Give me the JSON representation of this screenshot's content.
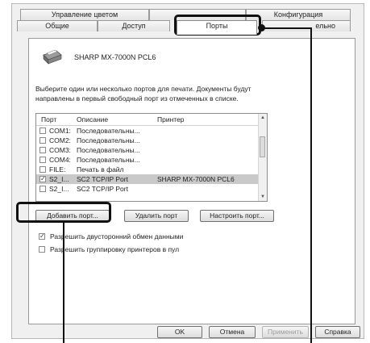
{
  "tabs": {
    "color_management": "Управление цветом",
    "config": "Конфигурация",
    "general": "Общие",
    "access": "Доступ",
    "ports": "Порты",
    "advanced_partial": "ельно"
  },
  "printer": {
    "name": "SHARP MX-7000N PCL6",
    "icon": "printer-icon"
  },
  "instructions": "Выберите один или несколько портов для печати. Документы будут направлены в первый свободный порт из отмеченных в списке.",
  "port_list": {
    "columns": [
      "Порт",
      "Описание",
      "Принтер"
    ],
    "rows": [
      {
        "port": "COM1:",
        "description": "Последовательны...",
        "printer": "",
        "checked": false,
        "selected": false
      },
      {
        "port": "COM2:",
        "description": "Последовательны...",
        "printer": "",
        "checked": false,
        "selected": false
      },
      {
        "port": "COM3:",
        "description": "Последовательны...",
        "printer": "",
        "checked": false,
        "selected": false
      },
      {
        "port": "COM4:",
        "description": "Последовательны...",
        "printer": "",
        "checked": false,
        "selected": false
      },
      {
        "port": "FILE:",
        "description": "Печать в файл",
        "printer": "",
        "checked": false,
        "selected": false
      },
      {
        "port": "S2_I...",
        "description": "SC2 TCP/IP Port",
        "printer": "SHARP MX-7000N PCL6",
        "checked": true,
        "selected": true
      },
      {
        "port": "S2_I...",
        "description": "SC2 TCP/IP Port",
        "printer": "",
        "checked": false,
        "selected": false
      }
    ]
  },
  "buttons": {
    "add_port": "Добавить порт...",
    "delete_port": "Удалить порт",
    "configure_port": "Настроить порт...",
    "ok": "OK",
    "cancel": "Отмена",
    "apply": "Применить",
    "help": "Справка"
  },
  "options": {
    "bidirectional": {
      "label": "Разрешить двусторонний обмен данными",
      "checked": true
    },
    "pooling": {
      "label": "Разрешить группировку принтеров в пул",
      "checked": false
    }
  }
}
